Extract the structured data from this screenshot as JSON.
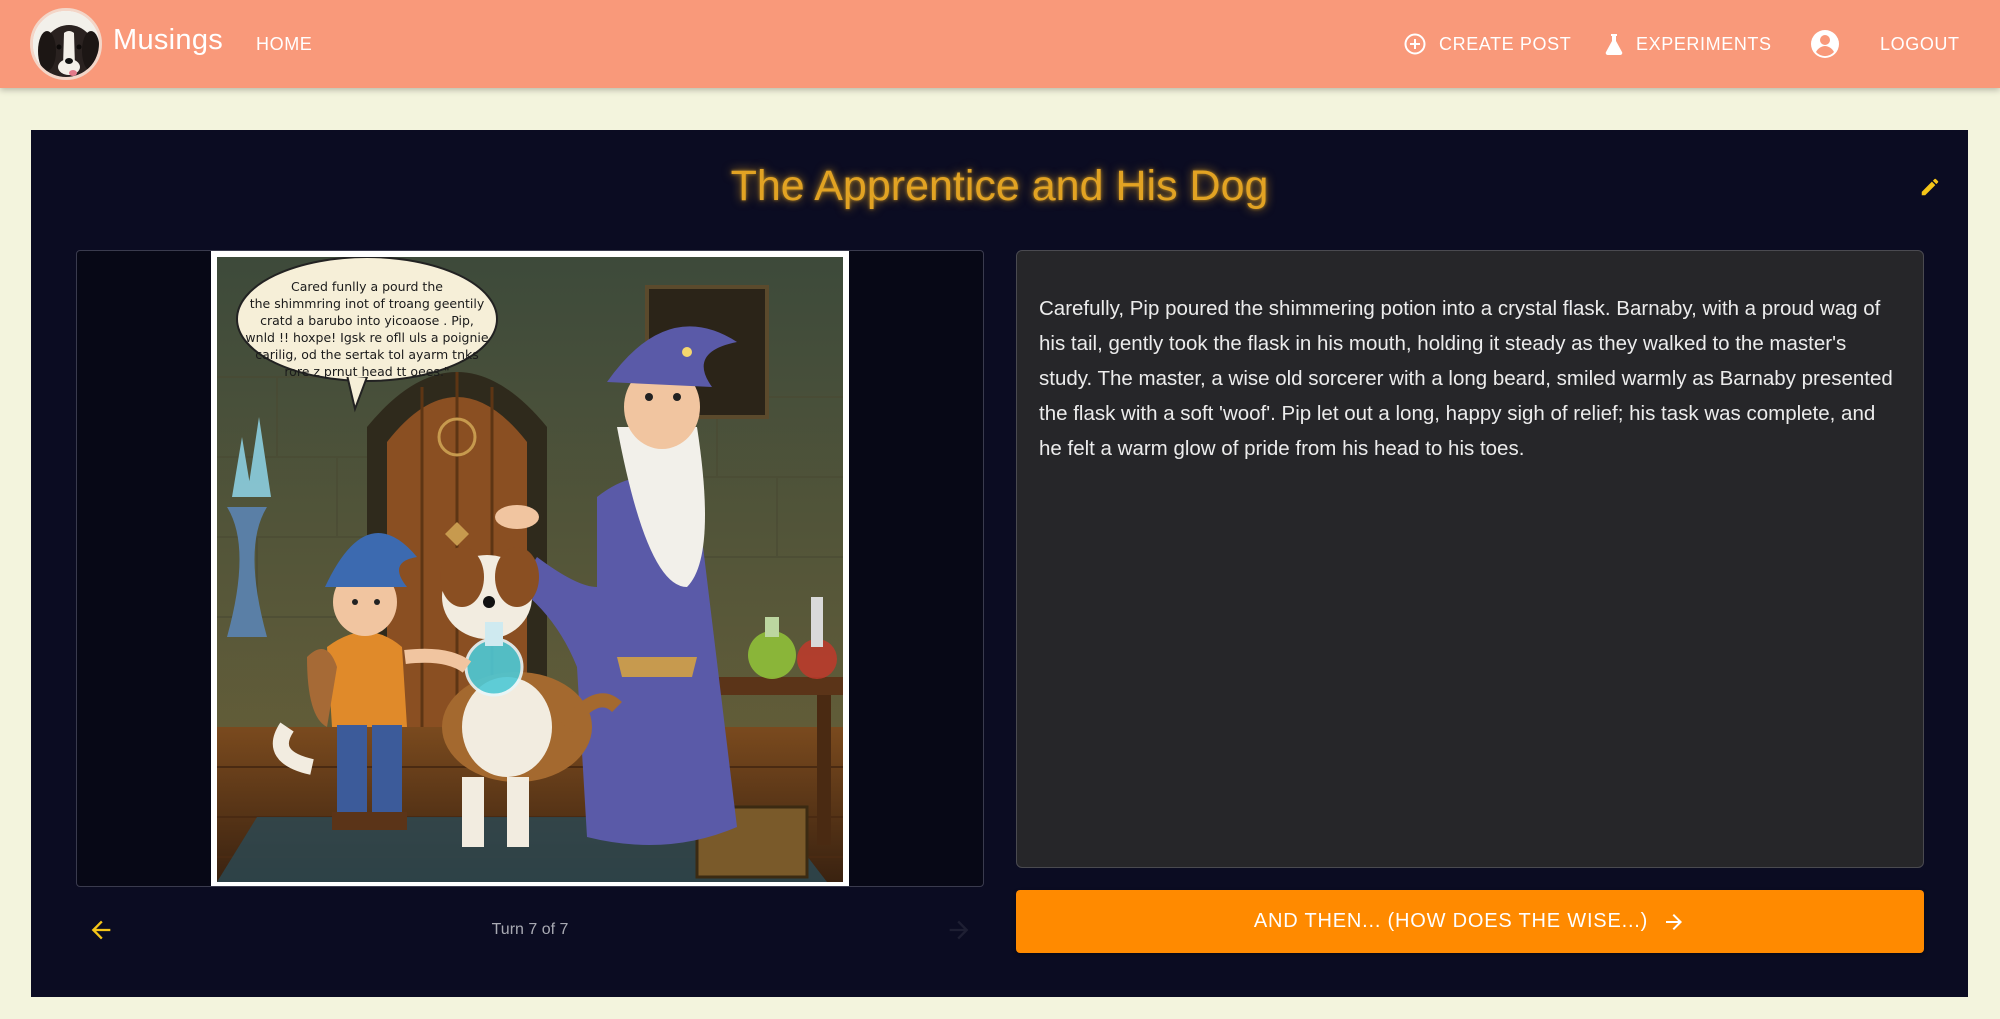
{
  "header": {
    "brand": "Musings",
    "nav": {
      "home": "HOME",
      "create_post": "CREATE POST",
      "experiments": "EXPERIMENTS",
      "logout": "LOGOUT"
    },
    "icons": {
      "logo": "dog-avatar-logo",
      "create_post": "plus-circle-icon",
      "experiments": "flask-icon",
      "account": "account-circle-icon"
    }
  },
  "story": {
    "title": "The Apprentice and His Dog",
    "text": "Carefully, Pip poured the shimmering potion into a crystal flask. Barnaby, with a proud wag of his tail, gently took the flask in his mouth, holding it steady as they walked to the master's study. The master, a wise old sorcerer with a long beard, smiled warmly as Barnaby presented the flask with a soft 'woof'. Pip let out a long, happy sigh of relief; his task was complete, and he felt a warm glow of pride from his head to his toes.",
    "turn_label": "Turn 7 of 7",
    "continue_label": "AND THEN... (HOW DOES THE WISE...)",
    "comic_speech": [
      "Cared funlly a pourd the",
      "the shimmring inot of troang geentily",
      "cratd a barubo into yicoaose . Pip,",
      "wnld !! hoxpe! Igsk re ofll uls a poignie",
      "carilig, od the sertak tol ayarm tnks",
      "rore z prnut head tt oees.\""
    ]
  },
  "colors": {
    "header_bg": "#f9997a",
    "page_bg": "#f3f4dd",
    "card_bg": "#0b0c22",
    "title": "#e2a323",
    "accent_yellow": "#f5c518",
    "cta_bg": "#ff8a00",
    "text_panel_bg": "#262629"
  }
}
